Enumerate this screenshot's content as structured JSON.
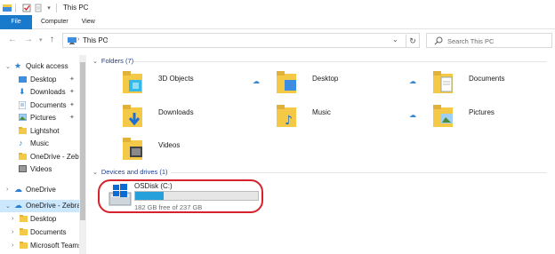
{
  "window": {
    "title": "This PC"
  },
  "ribbon": {
    "tabs": [
      "File",
      "Computer",
      "View"
    ]
  },
  "address": {
    "path": "This PC"
  },
  "search": {
    "placeholder": "Search This PC"
  },
  "nav": {
    "quick_access": "Quick access",
    "items": [
      {
        "label": "Desktop",
        "icon": "desktop-icon",
        "pinned": true
      },
      {
        "label": "Downloads",
        "icon": "downloads-icon",
        "pinned": true
      },
      {
        "label": "Documents",
        "icon": "documents-icon",
        "pinned": true
      },
      {
        "label": "Pictures",
        "icon": "pictures-icon",
        "pinned": true
      },
      {
        "label": "Lightshot",
        "icon": "folder-icon",
        "pinned": false
      },
      {
        "label": "Music",
        "icon": "music-icon",
        "pinned": false
      },
      {
        "label": "OneDrive - Zebra",
        "icon": "folder-icon",
        "pinned": false
      },
      {
        "label": "Videos",
        "icon": "videos-icon",
        "pinned": false
      }
    ],
    "onedrive": "OneDrive",
    "onedrive_zebra": "OneDrive - Zebra",
    "zebra_children": [
      {
        "label": "Desktop",
        "icon": "folder-icon"
      },
      {
        "label": "Documents",
        "icon": "folder-icon"
      },
      {
        "label": "Microsoft Teams",
        "icon": "folder-icon"
      }
    ]
  },
  "folders": {
    "header": "Folders (7)",
    "items": [
      {
        "label": "3D Objects",
        "icon": "3d-objects-icon",
        "cloud": true
      },
      {
        "label": "Desktop",
        "icon": "desktop-folder-icon",
        "cloud": true
      },
      {
        "label": "Documents",
        "icon": "documents-folder-icon",
        "cloud": false
      },
      {
        "label": "Downloads",
        "icon": "downloads-folder-icon",
        "cloud": false
      },
      {
        "label": "Music",
        "icon": "music-folder-icon",
        "cloud": true
      },
      {
        "label": "Pictures",
        "icon": "pictures-folder-icon",
        "cloud": false
      },
      {
        "label": "Videos",
        "icon": "videos-folder-icon",
        "cloud": false
      }
    ]
  },
  "drives": {
    "header": "Devices and drives (1)",
    "items": [
      {
        "label": "OSDisk (C:)",
        "free_text": "182 GB free of 237 GB",
        "used_fraction": 0.232
      }
    ]
  },
  "colors": {
    "accent": "#1979ca",
    "highlight": "#d6222a",
    "drive_bar": "#26a0da",
    "folder": "#f3c947"
  }
}
